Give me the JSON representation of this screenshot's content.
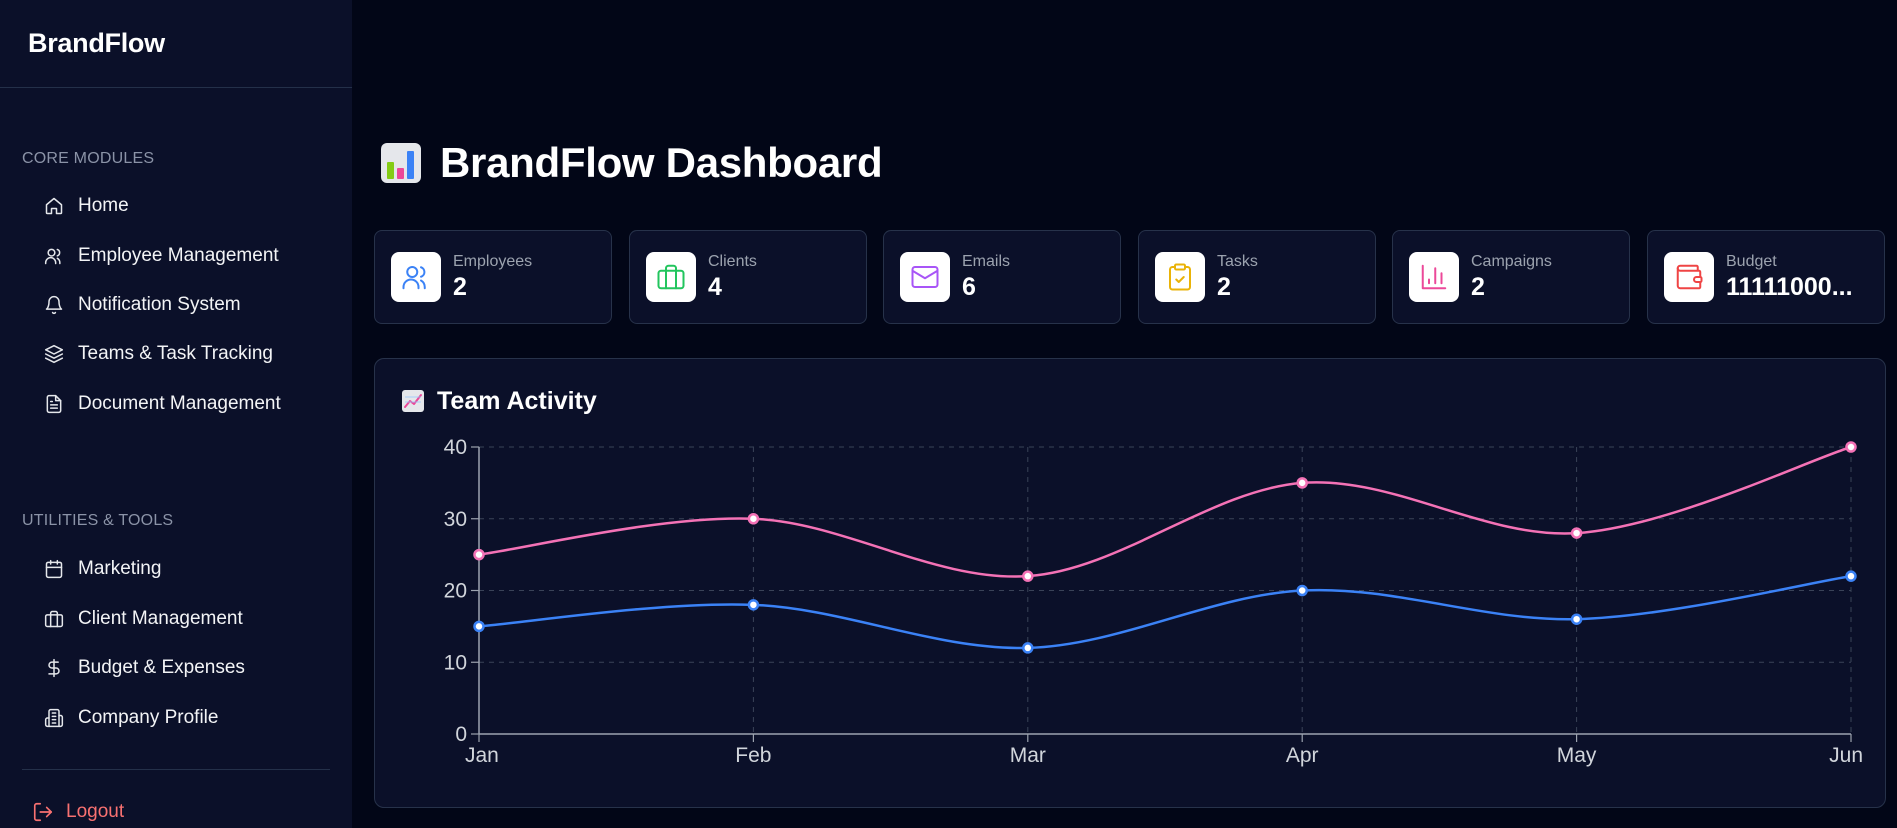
{
  "app": {
    "brand": "BrandFlow"
  },
  "sidebar": {
    "core_title": "CORE MODULES",
    "core_items": [
      {
        "label": "Home",
        "icon": "home-icon"
      },
      {
        "label": "Employee Management",
        "icon": "users-icon"
      },
      {
        "label": "Notification System",
        "icon": "bell-icon"
      },
      {
        "label": "Teams & Task Tracking",
        "icon": "layers-icon"
      },
      {
        "label": "Document Management",
        "icon": "file-icon"
      }
    ],
    "utilities_title": "UTILITIES & TOOLS",
    "utility_items": [
      {
        "label": "Marketing",
        "icon": "calendar-icon"
      },
      {
        "label": "Client Management",
        "icon": "briefcase-icon"
      },
      {
        "label": "Budget & Expenses",
        "icon": "dollar-icon"
      },
      {
        "label": "Company Profile",
        "icon": "building-icon"
      }
    ],
    "logout": "Logout"
  },
  "header": {
    "title": "BrandFlow Dashboard",
    "icon": "bar-chart-emoji-icon"
  },
  "stats": [
    {
      "label": "Employees",
      "value": "2",
      "icon": "users-icon",
      "color": "#3b82f6"
    },
    {
      "label": "Clients",
      "value": "4",
      "icon": "briefcase-icon",
      "color": "#22c55e"
    },
    {
      "label": "Emails",
      "value": "6",
      "icon": "mail-icon",
      "color": "#a855f7"
    },
    {
      "label": "Tasks",
      "value": "2",
      "icon": "clipboard-check-icon",
      "color": "#eab308"
    },
    {
      "label": "Campaigns",
      "value": "2",
      "icon": "bar-chart-icon",
      "color": "#ec4899"
    },
    {
      "label": "Budget",
      "value": "11111000...",
      "icon": "wallet-icon",
      "color": "#ef4444"
    }
  ],
  "chart": {
    "title": "Team Activity",
    "icon": "trend-emoji-icon"
  },
  "chart_data": {
    "type": "line",
    "x": [
      "Jan",
      "Feb",
      "Mar",
      "Apr",
      "May",
      "Jun"
    ],
    "y_ticks": [
      0,
      10,
      20,
      30,
      40
    ],
    "ylim": [
      0,
      40
    ],
    "grid": true,
    "series": [
      {
        "values": [
          25,
          30,
          22,
          35,
          28,
          40
        ],
        "color": "#f472b6"
      },
      {
        "values": [
          15,
          18,
          12,
          20,
          16,
          22
        ],
        "color": "#3b82f6"
      }
    ]
  }
}
